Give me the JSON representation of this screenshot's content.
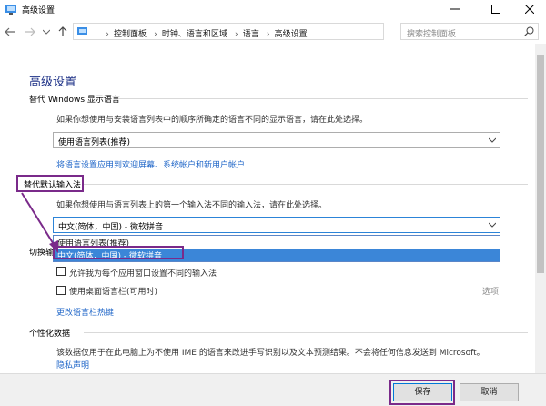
{
  "window": {
    "title": "高级设置"
  },
  "address": {
    "crumbs": [
      "控制面板",
      "时钟、语言和区域",
      "语言",
      "高级设置"
    ],
    "search_placeholder": "搜索控制面板"
  },
  "page": {
    "title": "高级设置",
    "display_section": {
      "title": "替代 Windows 显示语言",
      "description": "如果你想使用与安装语言列表中的顺序所确定的语言不同的显示语言，请在此处选择。",
      "selected": "使用语言列表(推荐)",
      "link": "将语言设置应用到欢迎屏幕、系统帐户和新用户帐户"
    },
    "input_section": {
      "title": "替代默认输入法",
      "description": "如果你想使用与语言列表上的第一个输入法不同的输入法，请在此处选择。",
      "selected": "中文(简体，中国) - 微软拼音",
      "options": [
        "使用语言列表(推荐)",
        "中文(简体，中国) - 微软拼音"
      ]
    },
    "switch_section": {
      "title": "切换输",
      "checkbox1": "允许我为每个应用窗口设置不同的输入法",
      "checkbox2": "使用桌面语言栏(可用时)",
      "options_link": "选项",
      "hotkey_link": "更改语言栏热键"
    },
    "personal_section": {
      "title": "个性化数据",
      "description": "该数据仅用于在此电脑上为不使用 IME 的语言来改进手写识别以及文本预测结果。不会将任何信息发送到 Microsoft。",
      "privacy_link": "隐私声明"
    }
  },
  "footer": {
    "save": "保存",
    "cancel": "取消"
  },
  "colors": {
    "annotation": "#7a2a8a",
    "link": "#1f66c8",
    "selection": "#3b86d8"
  }
}
